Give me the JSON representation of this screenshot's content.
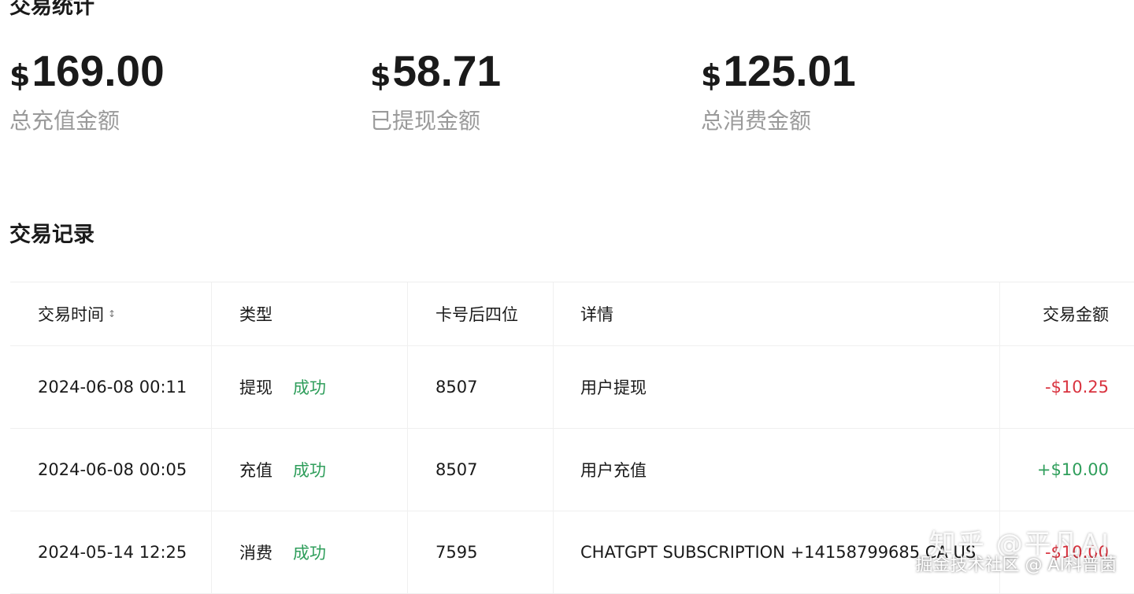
{
  "stats": {
    "title": "交易统计",
    "currency": "$",
    "items": [
      {
        "value": "169.00",
        "label": "总充值金额"
      },
      {
        "value": "58.71",
        "label": "已提现金额"
      },
      {
        "value": "125.01",
        "label": "总消费金额"
      }
    ]
  },
  "records": {
    "title": "交易记录",
    "columns": [
      "交易时间",
      "类型",
      "卡号后四位",
      "详情",
      "交易金额"
    ],
    "rows": [
      {
        "time": "2024-06-08 00:11",
        "type": "提现",
        "status": "成功",
        "card": "8507",
        "detail": "用户提现",
        "amount": "-$10.25"
      },
      {
        "time": "2024-06-08 00:05",
        "type": "充值",
        "status": "成功",
        "card": "8507",
        "detail": "用户充值",
        "amount": "+$10.00"
      },
      {
        "time": "2024-05-14 12:25",
        "type": "消费",
        "status": "成功",
        "card": "7595",
        "detail": "CHATGPT SUBSCRIPTION +14158799685 CA US",
        "amount": "-$10.00"
      }
    ]
  },
  "watermark": {
    "line1": "知乎 @平凡AI",
    "line2": "掘金技术社区 @ AI科普菌"
  },
  "colors": {
    "success": "#2f9e5b",
    "negative": "#d9333f",
    "muted_label": "#9a9a9a"
  },
  "icons": {
    "sort": "sort-icon"
  }
}
